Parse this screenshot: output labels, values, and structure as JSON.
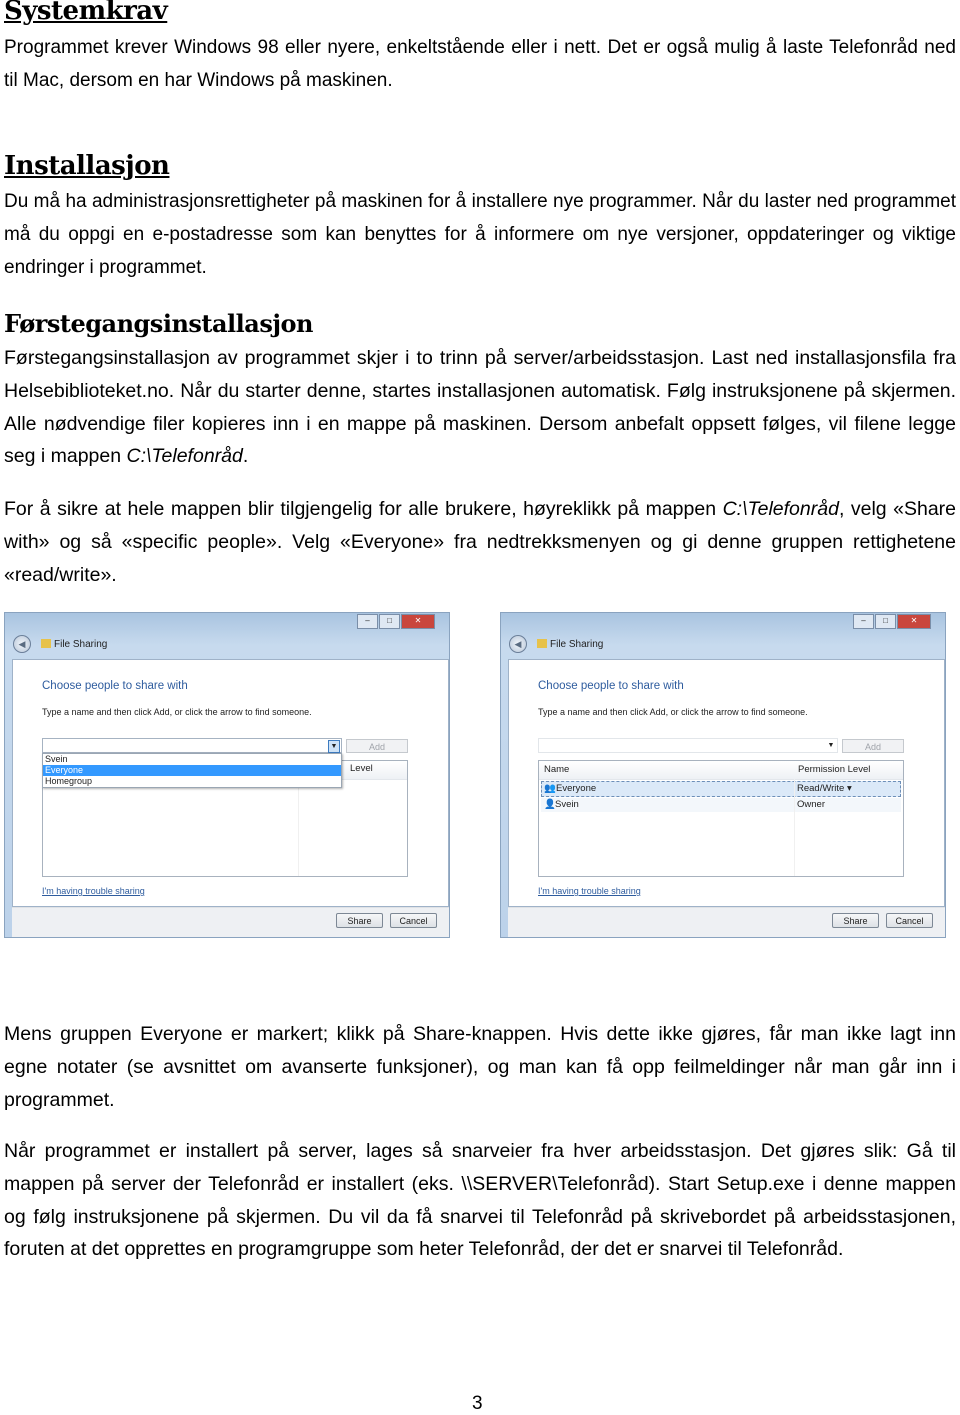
{
  "sections": {
    "systemkrav": {
      "title": "Systemkrav",
      "text": "Programmet krever Windows 98 eller nyere, enkeltstående eller i nett. Det er også mulig å laste Telefonråd ned til Mac, dersom en har Windows på maskinen."
    },
    "installasjon": {
      "title": "Installasjon",
      "text": "Du må ha administrasjonsrettigheter på maskinen for å installere nye programmer. Når du laster ned programmet må du oppgi en e-postadresse som kan benyttes for å informere om nye versjoner, oppdateringer og viktige endringer i programmet."
    },
    "forstegangs": {
      "title": "Førstegangsinstallasjon",
      "p1_a": "Førstegangsinstallasjon av programmet skjer i to trinn på server/arbeidsstasjon. Last ned installasjonsfila fra Helsebiblioteket.no. Når du starter denne, startes installasjonen automatisk. Følg instruksjonene på skjermen. Alle nødvendige filer kopieres inn i en mappe på maskinen. Dersom anbefalt oppsett følges, vil filene legge seg i mappen ",
      "p1_path": "C:\\Telefonråd",
      "p1_b": ".",
      "p2_a": "For å sikre at hele mappen blir tilgjengelig for alle brukere, høyreklikk på mappen ",
      "p2_path": "C:\\Telefonråd",
      "p2_b": ", velg «Share with» og så «specific people». Velg «Everyone» fra nedtrekksmenyen og gi denne gruppen rettighetene «read/write».",
      "p3": "Mens gruppen Everyone er markert; klikk på Share-knappen. Hvis dette ikke gjøres, får man ikke lagt inn egne notater (se avsnittet om avanserte funksjoner), og man kan få opp feilmeldinger når man går inn i programmet.",
      "p4": "Når programmet er installert på server, lages så snarveier fra hver arbeidsstasjon. Det gjøres slik: Gå til mappen på server der Telefonråd er installert (eks. \\\\SERVER\\Telefonråd). Start Setup.exe i denne mappen og følg instruksjonene på skjermen. Du vil da få snarvei til Telefonråd på skrivebordet på arbeidsstasjonen, foruten at det opprettes en programgruppe som heter Telefonråd, der det er snarvei til Telefonråd."
    }
  },
  "screenshots": [
    {
      "window_title": "File Sharing",
      "heading": "Choose people to share with",
      "instruction": "Type a name and then click Add, or click the arrow to find someone.",
      "add_label": "Add",
      "dropdown_options": [
        "Svein",
        "Everyone",
        "Homegroup"
      ],
      "dropdown_selected": "Everyone",
      "partial_header": "Level",
      "link": "I'm having trouble sharing",
      "share_label": "Share",
      "cancel_label": "Cancel"
    },
    {
      "window_title": "File Sharing",
      "heading": "Choose people to share with",
      "instruction": "Type a name and then click Add, or click the arrow to find someone.",
      "add_label": "Add",
      "col_name": "Name",
      "col_permission": "Permission Level",
      "rows": [
        {
          "name": "Everyone",
          "permission": "Read/Write ▾",
          "selected": true
        },
        {
          "name": "Svein",
          "permission": "Owner",
          "selected": false
        }
      ],
      "link": "I'm having trouble sharing",
      "share_label": "Share",
      "cancel_label": "Cancel"
    }
  ],
  "page_number": "3"
}
